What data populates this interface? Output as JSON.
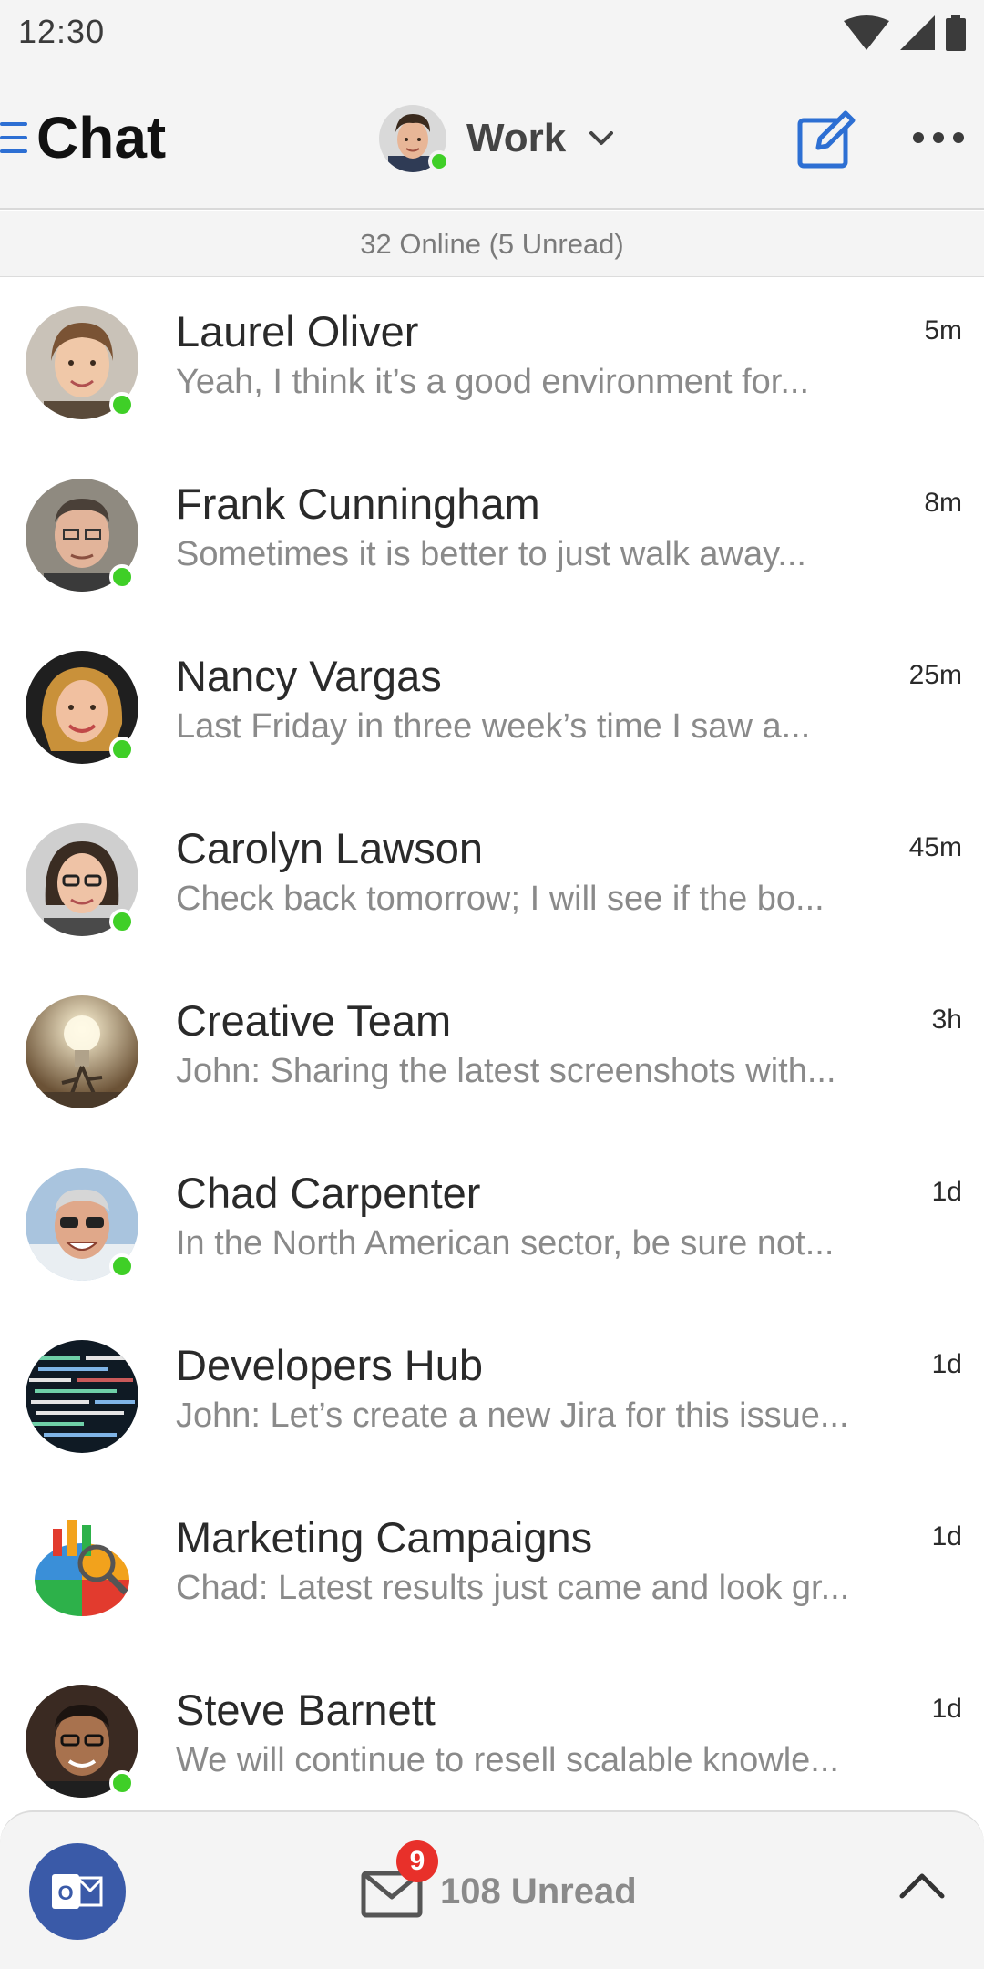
{
  "status_bar": {
    "time": "12:30"
  },
  "header": {
    "title": "Chat",
    "account": "Work",
    "icons": {
      "menu": "hamburger-icon",
      "compose": "compose-icon",
      "more": "more-icon",
      "chevron": "chevron-down-icon"
    },
    "accent_color": "#2d6fd3"
  },
  "online_summary": "32 Online (5 Unread)",
  "chats": [
    {
      "name": "Laurel Oliver",
      "time": "5m",
      "preview": "Yeah, I think it’s a good environment for...",
      "online": true
    },
    {
      "name": "Frank Cunningham",
      "time": "8m",
      "preview": "Sometimes it is better to just walk away...",
      "online": true
    },
    {
      "name": "Nancy Vargas",
      "time": "25m",
      "preview": "Last Friday in three week’s time I saw a...",
      "online": true
    },
    {
      "name": "Carolyn Lawson",
      "time": "45m",
      "preview": "Check back tomorrow; I will see if the bo...",
      "online": true
    },
    {
      "name": "Creative Team",
      "time": "3h",
      "preview": "John: Sharing the latest screenshots with...",
      "online": false
    },
    {
      "name": "Chad Carpenter",
      "time": "1d",
      "preview": "In the North American sector, be sure not...",
      "online": true
    },
    {
      "name": "Developers Hub",
      "time": "1d",
      "preview": "John: Let’s create a new Jira for this issue...",
      "online": false
    },
    {
      "name": "Marketing Campaigns",
      "time": "1d",
      "preview": "Chad: Latest results just came and look gr...",
      "online": false
    },
    {
      "name": "Steve Barnett",
      "time": "1d",
      "preview": "We will continue to resell scalable knowle...",
      "online": true
    }
  ],
  "bottom_bar": {
    "badge_count": "9",
    "unread_label": "108 Unread",
    "outlook_letter": "O",
    "icons": {
      "outlook": "outlook-icon",
      "mail": "mail-icon",
      "expand": "chevron-up-icon"
    }
  },
  "colors": {
    "online": "#3fcf27",
    "badge": "#e8302a",
    "outlook": "#3a5aa8"
  }
}
